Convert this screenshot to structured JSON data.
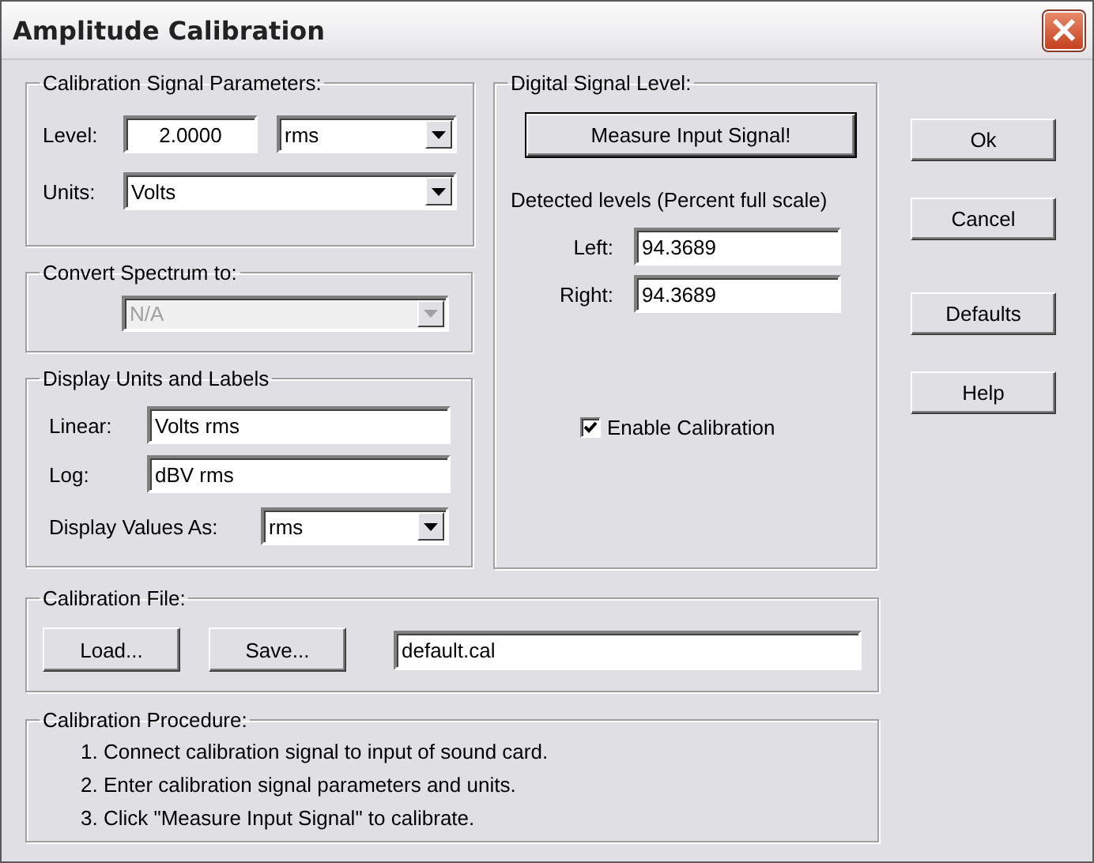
{
  "window": {
    "title": "Amplitude Calibration"
  },
  "signal_parameters": {
    "title": "Calibration Signal Parameters:",
    "level_label": "Level:",
    "level_value": "2.0000",
    "level_mode": "rms",
    "units_label": "Units:",
    "units": "Volts"
  },
  "convert_spectrum": {
    "title": "Convert Spectrum to:",
    "value": "N/A",
    "disabled": true
  },
  "display_units": {
    "title": "Display Units and Labels",
    "linear_label": "Linear:",
    "linear": "Volts rms",
    "log_label": "Log:",
    "log": "dBV rms",
    "display_as_label": "Display Values As:",
    "display_as": "rms"
  },
  "digital_signal": {
    "title": "Digital Signal Level:",
    "measure_button": "Measure Input Signal!",
    "detected_label": "Detected levels (Percent full scale)",
    "channels": [
      {
        "label": "Left:",
        "value": "94.3689"
      },
      {
        "label": "Right:",
        "value": "94.3689"
      }
    ],
    "enable_calibration": {
      "label": "Enable Calibration",
      "checked": true
    }
  },
  "calibration_file": {
    "title": "Calibration File:",
    "buttons": [
      "Load...",
      "Save..."
    ],
    "file": "default.cal"
  },
  "procedure": {
    "title": "Calibration Procedure:",
    "steps": [
      "1. Connect calibration signal to input of sound card.",
      "2. Enter calibration signal parameters and units.",
      "3. Click \"Measure Input Signal\" to calibrate."
    ]
  },
  "buttons": [
    "Ok",
    "Cancel",
    "Defaults",
    "Help"
  ]
}
